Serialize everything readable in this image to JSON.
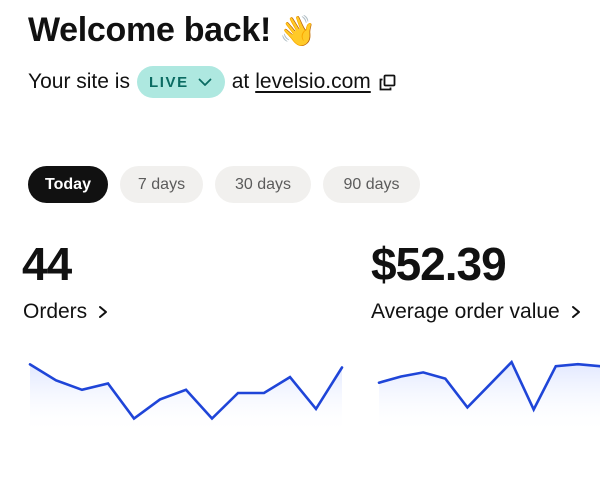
{
  "header": {
    "welcome": "Welcome back!",
    "wave_emoji": "👋",
    "site_prefix": "Your site is",
    "status_badge": "LIVE",
    "at_text": "at",
    "domain": "levelsio.com"
  },
  "icons": {
    "badge_dropdown": "chevron-down-icon",
    "domain_link": "external-link-icon",
    "metric_link": "chevron-right-icon"
  },
  "colors": {
    "live_badge_bg": "#aee8e0",
    "live_badge_text": "#0a6b62",
    "active_tab_bg": "#111111",
    "inactive_tab_bg": "#f1f0ee",
    "sparkline": "#1f45d8"
  },
  "period_tabs": {
    "selected": "Today",
    "items": [
      "Today",
      "7 days",
      "30 days",
      "90 days"
    ]
  },
  "metrics": [
    {
      "value": "44",
      "label": "Orders",
      "trend": [
        20,
        15,
        12,
        14,
        3,
        9,
        12,
        3,
        11,
        11,
        16,
        6,
        19
      ]
    },
    {
      "value": "$52.39",
      "label": "Average order value",
      "trend": [
        22,
        25,
        27,
        24,
        10,
        21,
        32,
        9,
        30,
        31,
        30
      ]
    }
  ]
}
